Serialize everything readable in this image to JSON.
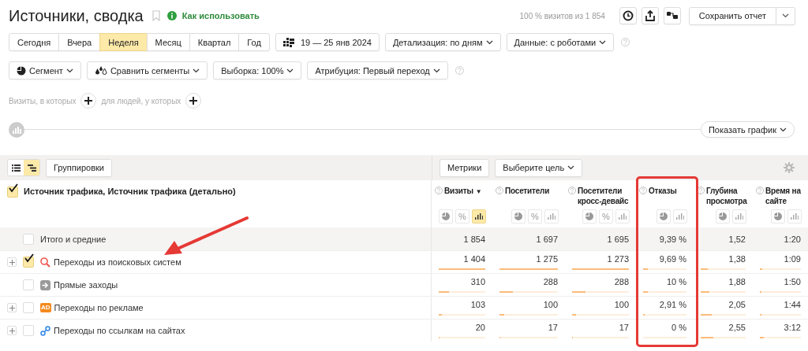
{
  "page": {
    "title": "Источники, сводка",
    "bookmarked": false,
    "help_link": "Как использовать",
    "sample_info": "100 % визитов из 1 854",
    "save_button": "Сохранить отчет"
  },
  "periods": [
    {
      "label": "Сегодня",
      "selected": false
    },
    {
      "label": "Вчера",
      "selected": false
    },
    {
      "label": "Неделя",
      "selected": true
    },
    {
      "label": "Месяц",
      "selected": false
    },
    {
      "label": "Квартал",
      "selected": false
    },
    {
      "label": "Год",
      "selected": false
    }
  ],
  "date_range": "19 — 25 янв 2024",
  "settings": [
    "Детализация: по дням",
    "Данные: с роботами"
  ],
  "filters": [
    {
      "kind": "segment",
      "label": "Сегмент"
    },
    {
      "kind": "compare",
      "label": "Сравнить сегменты"
    },
    {
      "kind": "plain",
      "label": "Выборка: 100%"
    },
    {
      "kind": "plain",
      "label": "Атрибуция: Первый переход"
    }
  ],
  "conditions": [
    "Визиты, в которых",
    "для людей, у которых"
  ],
  "chart_button": "Показать график",
  "toolbar": {
    "views": [
      {
        "kind": "list",
        "selected": false
      },
      {
        "kind": "tree",
        "selected": true
      }
    ],
    "groupings": "Группировки",
    "metrics": "Метрики",
    "goal": "Выберите цель"
  },
  "table": {
    "dimension": {
      "label": "Источник трафика, Источник трафика (детально)",
      "checked": true
    },
    "columns": [
      {
        "label": "Визиты",
        "sort_mark": "▼",
        "highlighted": false,
        "views": [
          {
            "kind": "pie",
            "selected": false
          },
          {
            "kind": "percent",
            "label": "%",
            "selected": false
          },
          {
            "kind": "bars",
            "selected": true
          }
        ]
      },
      {
        "label": "Посетители",
        "highlighted": false,
        "views": [
          {
            "kind": "pie",
            "selected": false
          },
          {
            "kind": "percent",
            "label": "%",
            "selected": false
          },
          {
            "kind": "bars",
            "selected": false
          }
        ]
      },
      {
        "label": "Посетители кросс-девайс",
        "highlighted": false,
        "views": [
          {
            "kind": "pie",
            "selected": false
          },
          {
            "kind": "percent",
            "label": "%",
            "selected": false
          },
          {
            "kind": "bars",
            "selected": false
          }
        ]
      },
      {
        "label": "Отказы",
        "highlighted": true,
        "views": [
          {
            "kind": "pie",
            "selected": false
          },
          {
            "kind": "bars",
            "selected": false
          }
        ]
      },
      {
        "label": "Глубина просмотра",
        "highlighted": false,
        "views": [
          {
            "kind": "pie",
            "selected": false
          },
          {
            "kind": "bars",
            "selected": false
          }
        ]
      },
      {
        "label": "Время на сайте",
        "highlighted": false,
        "views": [
          {
            "kind": "pie",
            "selected": false
          },
          {
            "kind": "bars",
            "selected": false
          }
        ]
      }
    ],
    "totals": {
      "label": "Итого и средние",
      "checked": false,
      "values": [
        "1 854",
        "1 697",
        "1 695",
        "9,39 %",
        "1,52",
        "1:20"
      ]
    },
    "rows": [
      {
        "label": "Переходы из поисковых систем",
        "kind": "search",
        "expandable": true,
        "checked": true,
        "arrow": true,
        "cells": [
          {
            "value": "1 404",
            "level": 1
          },
          {
            "value": "1 275",
            "level": 1
          },
          {
            "value": "1 273",
            "level": 1
          },
          {
            "value": "9,69 %",
            "level": 0.1
          },
          {
            "value": "1,38",
            "level": 0.15
          },
          {
            "value": "1:09",
            "level": 0.05
          }
        ]
      },
      {
        "label": "Прямые заходы",
        "kind": "direct",
        "expandable": false,
        "checked": false,
        "arrow": false,
        "cells": [
          {
            "value": "310",
            "level": 0.22
          },
          {
            "value": "288",
            "level": 0.23
          },
          {
            "value": "288",
            "level": 0.23
          },
          {
            "value": "10 %",
            "level": 0.1
          },
          {
            "value": "1,88",
            "level": 0.2
          },
          {
            "value": "1:50",
            "level": 0.04
          }
        ]
      },
      {
        "label": "Переходы по рекламе",
        "kind": "ad",
        "badge": "AD",
        "expandable": true,
        "checked": false,
        "arrow": false,
        "cells": [
          {
            "value": "103",
            "level": 0.07
          },
          {
            "value": "100",
            "level": 0.08
          },
          {
            "value": "100",
            "level": 0.07
          },
          {
            "value": "2,91 %",
            "level": 0.03
          },
          {
            "value": "2,05",
            "level": 0.24
          },
          {
            "value": "1:44",
            "level": 0.04
          }
        ]
      },
      {
        "label": "Переходы по ссылкам на сайтах",
        "kind": "link",
        "expandable": true,
        "checked": false,
        "arrow": false,
        "cells": [
          {
            "value": "20",
            "level": 0.01
          },
          {
            "value": "17",
            "level": 0.01
          },
          {
            "value": "17",
            "level": 0.01
          },
          {
            "value": "0 %",
            "level": 0
          },
          {
            "value": "2,55",
            "level": 0.28
          },
          {
            "value": "3:12",
            "level": 0.09
          }
        ]
      }
    ]
  }
}
